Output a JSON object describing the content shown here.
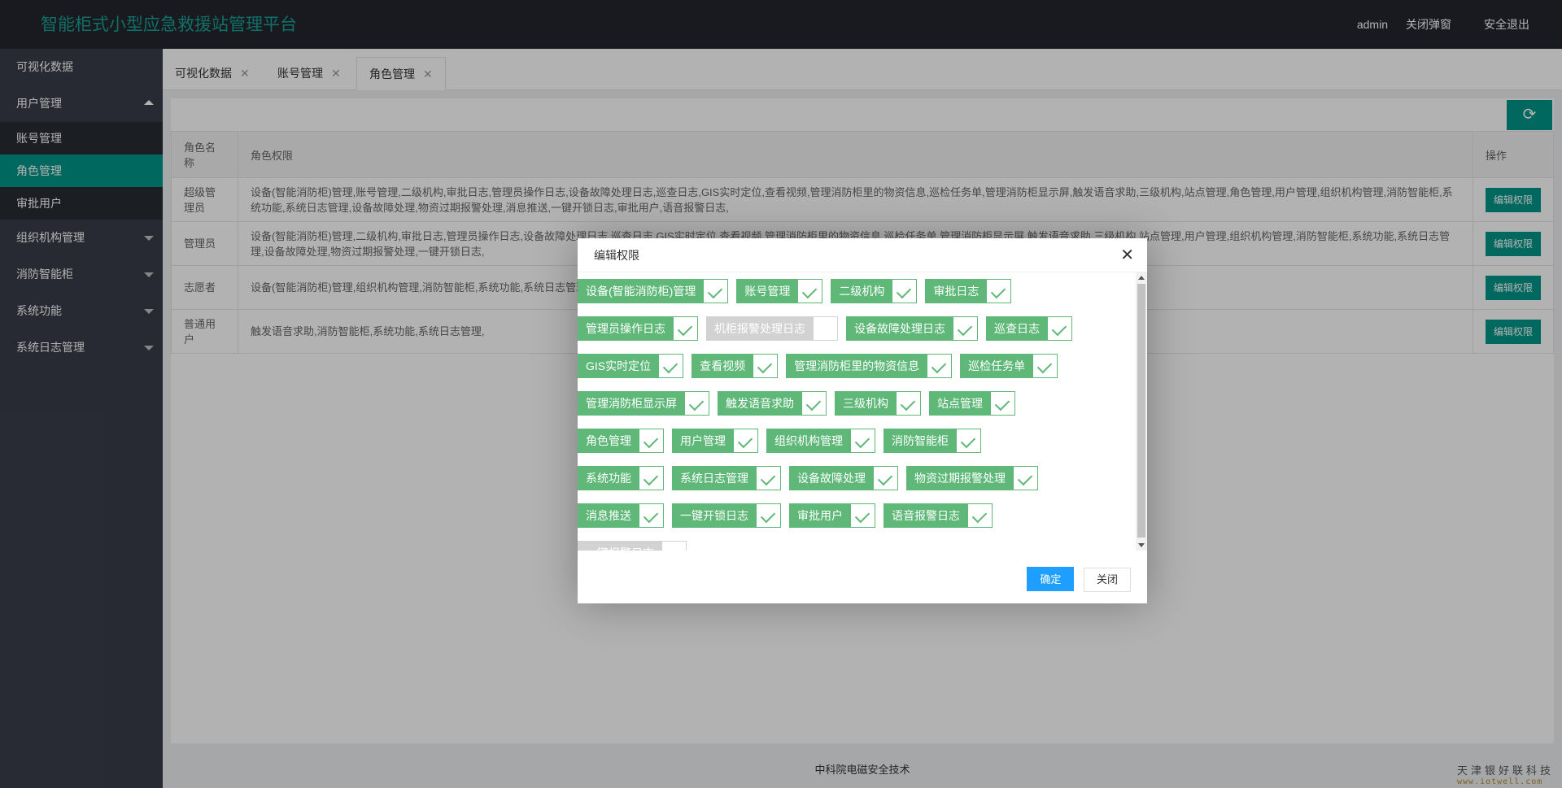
{
  "header": {
    "title": "智能柜式小型应急救援站管理平台",
    "user": "admin",
    "close_popup": "关闭弹窗",
    "logout": "安全退出"
  },
  "sidebar": {
    "visual": "可视化数据",
    "user_mgmt": "用户管理",
    "sub": {
      "account": "账号管理",
      "role": "角色管理",
      "approve": "审批用户"
    },
    "org": "组织机构管理",
    "cabinet": "消防智能柜",
    "sysfunc": "系统功能",
    "syslog": "系统日志管理"
  },
  "tabs": [
    {
      "label": "可视化数据"
    },
    {
      "label": "账号管理"
    },
    {
      "label": "角色管理"
    }
  ],
  "tab_close_glyph": "✕",
  "table": {
    "headers": {
      "name": "角色名称",
      "perms": "角色权限",
      "op": "操作"
    },
    "rows": [
      {
        "name": "超级管理员",
        "perms": "设备(智能消防柜)管理,账号管理,二级机构,审批日志,管理员操作日志,设备故障处理日志,巡查日志,GIS实时定位,查看视频,管理消防柜里的物资信息,巡检任务单,管理消防柜显示屏,触发语音求助,三级机构,站点管理,角色管理,用户管理,组织机构管理,消防智能柜,系统功能,系统日志管理,设备故障处理,物资过期报警处理,消息推送,一键开锁日志,审批用户,语音报警日志,",
        "op": "编辑权限"
      },
      {
        "name": "管理员",
        "perms": "设备(智能消防柜)管理,二级机构,审批日志,管理员操作日志,设备故障处理日志,巡查日志,GIS实时定位,查看视频,管理消防柜里的物资信息,巡检任务单,管理消防柜显示屏,触发语音求助,三级机构,站点管理,用户管理,组织机构管理,消防智能柜,系统功能,系统日志管理,设备故障处理,物资过期报警处理,一键开锁日志,",
        "op": "编辑权限"
      },
      {
        "name": "志愿者",
        "perms": "设备(智能消防柜)管理,组织机构管理,消防智能柜,系统功能,系统日志管理,",
        "op": "编辑权限"
      },
      {
        "name": "普通用户",
        "perms": "触发语音求助,消防智能柜,系统功能,系统日志管理,",
        "op": "编辑权限"
      }
    ]
  },
  "footer": {
    "text": "中科院电磁安全技术",
    "watermark": "天津银好联科技",
    "watermark_url": "www.iotwell.com"
  },
  "modal": {
    "title": "编辑权限",
    "close_glyph": "✕",
    "ok": "确定",
    "cancel": "关闭",
    "rows": [
      [
        {
          "label": "设备(智能消防柜)管理",
          "checked": true
        },
        {
          "label": "账号管理",
          "checked": true
        },
        {
          "label": "二级机构",
          "checked": true
        },
        {
          "label": "审批日志",
          "checked": true
        }
      ],
      [
        {
          "label": "管理员操作日志",
          "checked": true
        },
        {
          "label": "机柜报警处理日志",
          "checked": false
        },
        {
          "label": "设备故障处理日志",
          "checked": true
        },
        {
          "label": "巡查日志",
          "checked": true
        }
      ],
      [
        {
          "label": "GIS实时定位",
          "checked": true
        },
        {
          "label": "查看视频",
          "checked": true
        },
        {
          "label": "管理消防柜里的物资信息",
          "checked": true
        },
        {
          "label": "巡检任务单",
          "checked": true
        }
      ],
      [
        {
          "label": "管理消防柜显示屏",
          "checked": true
        },
        {
          "label": "触发语音求助",
          "checked": true
        },
        {
          "label": "三级机构",
          "checked": true
        },
        {
          "label": "站点管理",
          "checked": true
        }
      ],
      [
        {
          "label": "角色管理",
          "checked": true
        },
        {
          "label": "用户管理",
          "checked": true
        },
        {
          "label": "组织机构管理",
          "checked": true
        },
        {
          "label": "消防智能柜",
          "checked": true
        }
      ],
      [
        {
          "label": "系统功能",
          "checked": true
        },
        {
          "label": "系统日志管理",
          "checked": true
        },
        {
          "label": "设备故障处理",
          "checked": true
        },
        {
          "label": "物资过期报警处理",
          "checked": true
        }
      ],
      [
        {
          "label": "消息推送",
          "checked": true
        },
        {
          "label": "一键开锁日志",
          "checked": true
        },
        {
          "label": "审批用户",
          "checked": true
        },
        {
          "label": "语音报警日志",
          "checked": true
        }
      ],
      [
        {
          "label": "一键报警日志",
          "checked": false
        }
      ]
    ]
  },
  "icons": {
    "refresh": "refresh-icon",
    "accent": "#009688",
    "check_color": "#5fb878",
    "primary_btn": "#1e9fff"
  }
}
